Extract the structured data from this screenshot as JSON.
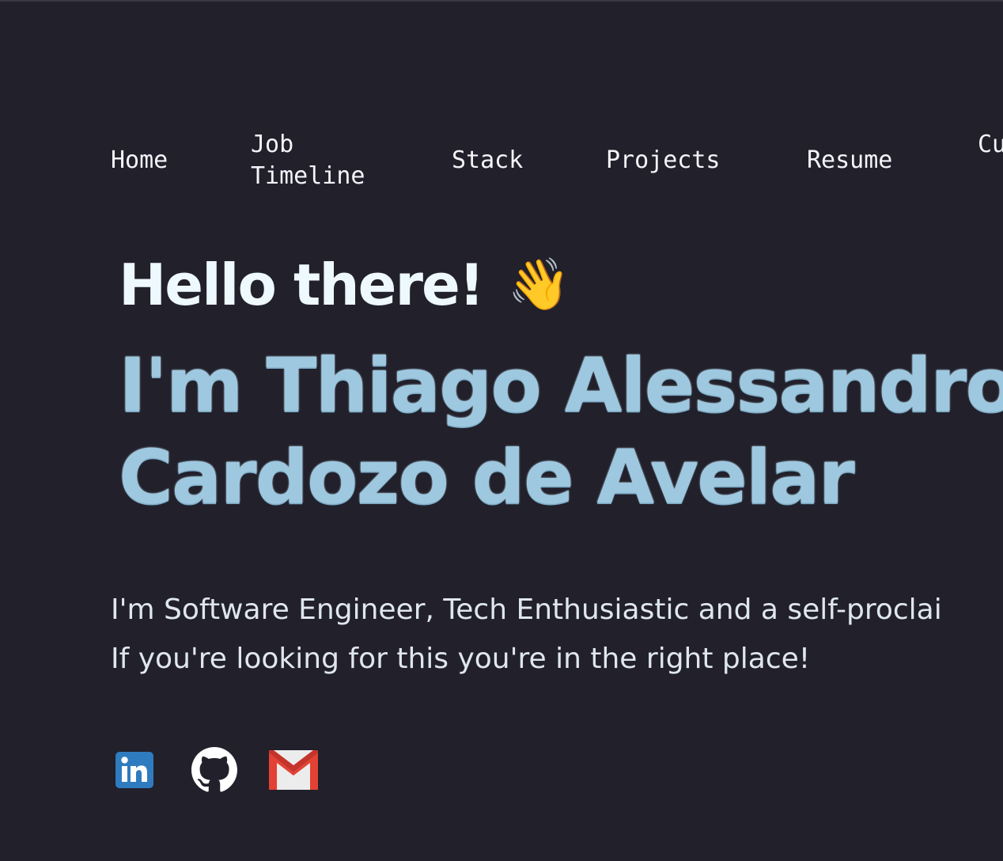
{
  "nav": {
    "items": [
      {
        "label": "Home"
      },
      {
        "label": "Job Timeline"
      },
      {
        "label": "Stack"
      },
      {
        "label": "Projects"
      },
      {
        "label": "Resume"
      },
      {
        "label": "Cu em"
      }
    ]
  },
  "hero": {
    "greeting": "Hello there!",
    "wave_emoji": "👋",
    "name_line1": "I'm Thiago Alessandro",
    "name_line2": "Cardozo de Avelar",
    "intro_line1": "I'm Software Engineer, Tech Enthusiastic and a self-proclai",
    "intro_line2": "If you're looking for this you're in the right place!"
  },
  "socials": {
    "icons": [
      "linkedin-icon",
      "github-icon",
      "gmail-icon"
    ]
  },
  "colors": {
    "background": "#21202b",
    "nav_text": "#f3f4f8",
    "greeting": "#eef8ff",
    "name_accent": "#9ec8df",
    "intro_text": "#dfe6f0",
    "linkedin": "#2f7bbf",
    "gmail_red": "#e34133"
  }
}
